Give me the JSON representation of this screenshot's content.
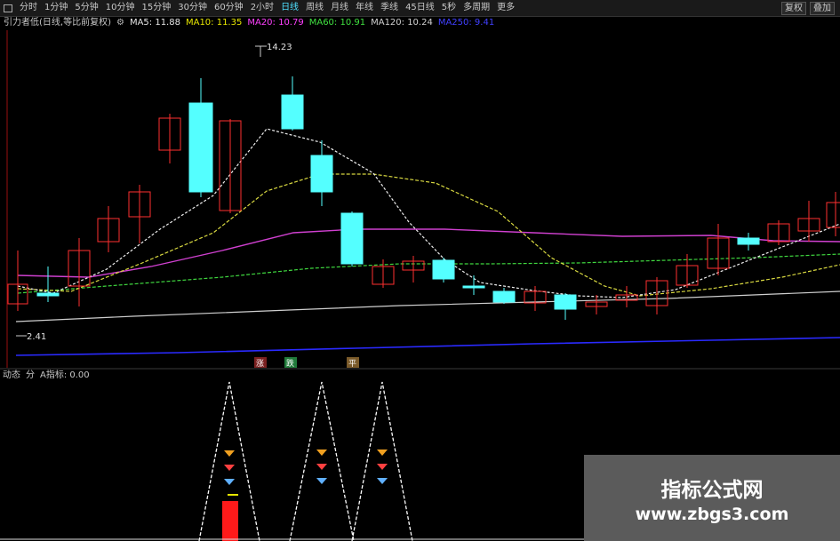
{
  "toolbar": {
    "tabs": [
      "分时",
      "1分钟",
      "5分钟",
      "10分钟",
      "15分钟",
      "30分钟",
      "60分钟",
      "2小时",
      "日线",
      "周线",
      "月线",
      "年线",
      "季线",
      "45日线",
      "5秒",
      "多周期",
      "更多"
    ],
    "active_tab": "日线",
    "right_buttons": [
      "复权",
      "叠加"
    ]
  },
  "indicator_bar": {
    "title": "引力者低(日线,等比前复权)",
    "items": [
      {
        "label": "MA5: 11.88",
        "color": "#e6e6e6"
      },
      {
        "label": "MA10: 11.35",
        "color": "#e6e600"
      },
      {
        "label": "MA20: 10.79",
        "color": "#ff40ff"
      },
      {
        "label": "MA60: 10.91",
        "color": "#40e040"
      },
      {
        "label": "MA120: 10.24",
        "color": "#d0d0d0"
      },
      {
        "label": "MA250: 9.41",
        "color": "#4040ff"
      }
    ]
  },
  "sub_bar": {
    "items": [
      "动态",
      "分",
      "A指标: 0.00"
    ]
  },
  "price_labels": {
    "high": "14.23",
    "low": "2.41"
  },
  "markers": [
    "涨",
    "跌",
    "平"
  ],
  "watermark": {
    "title": "指标公式网",
    "url": "www.zbgs3.com"
  },
  "colors": {
    "up": "#ff3030",
    "down": "#54ffff",
    "background": "#000000"
  }
}
